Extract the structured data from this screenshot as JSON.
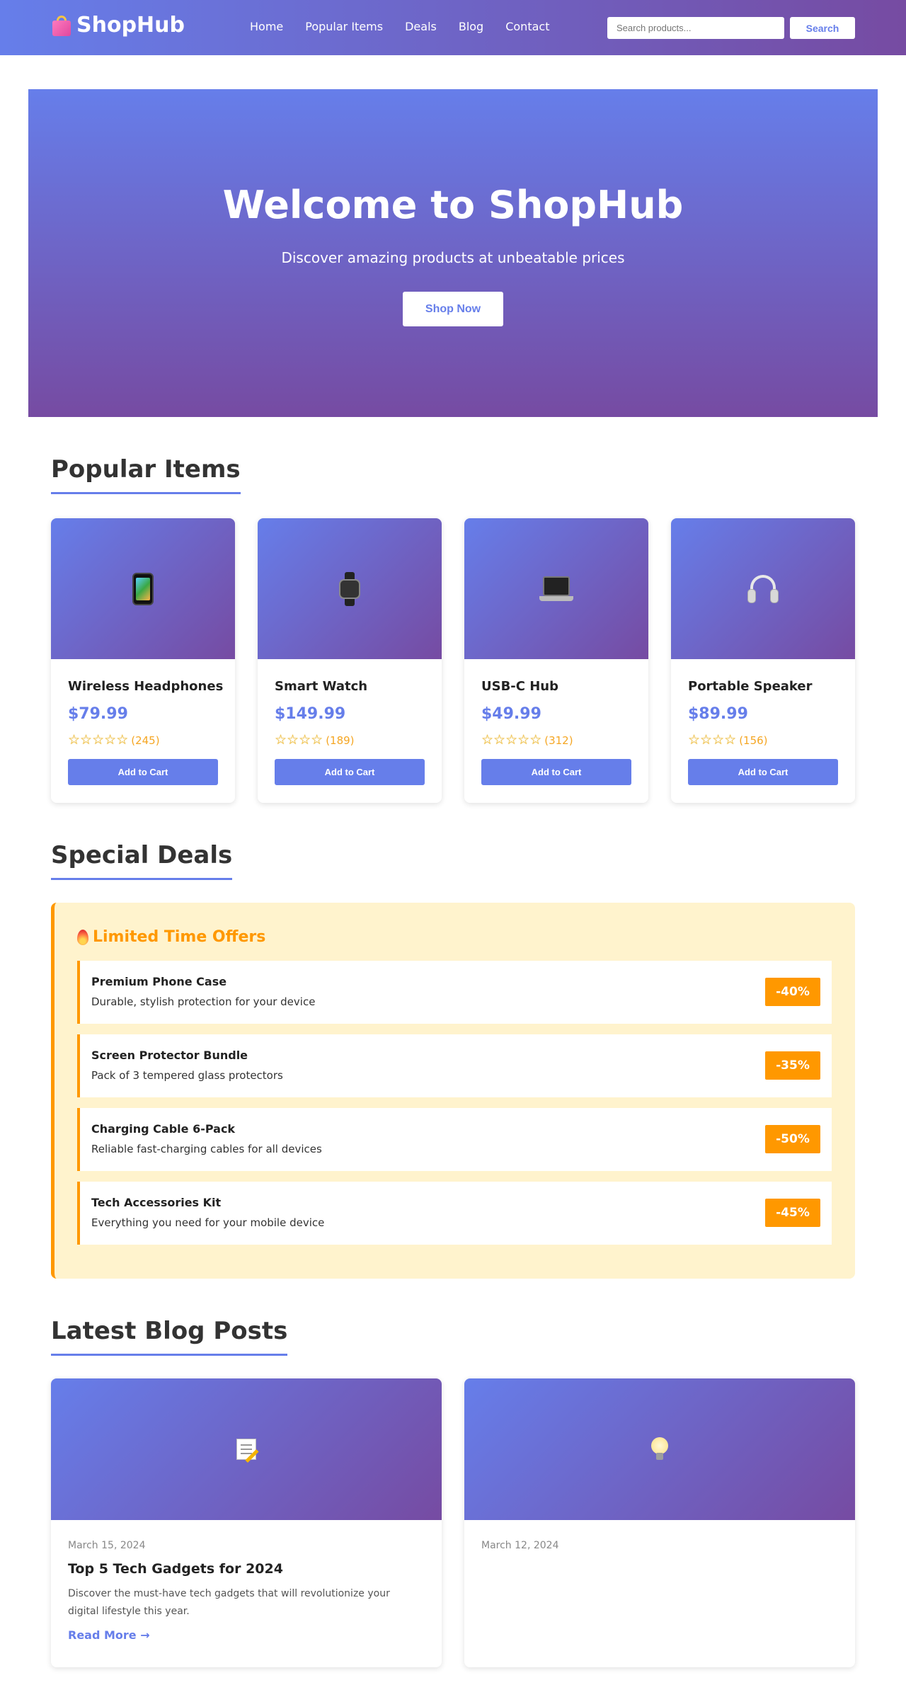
{
  "header": {
    "brand": "ShopHub",
    "nav": [
      "Home",
      "Popular Items",
      "Deals",
      "Blog",
      "Contact"
    ],
    "search_placeholder": "Search products...",
    "search_button": "Search"
  },
  "hero": {
    "title": "Welcome to ShopHub",
    "subtitle": "Discover amazing products at unbeatable prices",
    "cta": "Shop Now"
  },
  "popular": {
    "title": "Popular Items",
    "add_label": "Add to Cart",
    "items": [
      {
        "icon": "smartphone-icon",
        "name": "Wireless Headphones",
        "price": "$79.99",
        "stars": 5,
        "reviews": "(245)"
      },
      {
        "icon": "smartwatch-icon",
        "name": "Smart Watch",
        "price": "$149.99",
        "stars": 4,
        "reviews": "(189)"
      },
      {
        "icon": "laptop-icon",
        "name": "USB-C Hub",
        "price": "$49.99",
        "stars": 5,
        "reviews": "(312)"
      },
      {
        "icon": "headphones-icon",
        "name": "Portable Speaker",
        "price": "$89.99",
        "stars": 4,
        "reviews": "(156)"
      }
    ]
  },
  "deals": {
    "title": "Special Deals",
    "box_title": "Limited Time Offers",
    "items": [
      {
        "name": "Premium Phone Case",
        "desc": "Durable, stylish protection for your device",
        "discount": "-40%"
      },
      {
        "name": "Screen Protector Bundle",
        "desc": "Pack of 3 tempered glass protectors",
        "discount": "-35%"
      },
      {
        "name": "Charging Cable 6-Pack",
        "desc": "Reliable fast-charging cables for all devices",
        "discount": "-50%"
      },
      {
        "name": "Tech Accessories Kit",
        "desc": "Everything you need for your mobile device",
        "discount": "-45%"
      }
    ]
  },
  "blog": {
    "title": "Latest Blog Posts",
    "posts": [
      {
        "icon": "memo-icon",
        "date": "March 15, 2024",
        "title": "Top 5 Tech Gadgets for 2024",
        "excerpt": "Discover the must-have tech gadgets that will revolutionize your digital lifestyle this year.",
        "link": "Read More →"
      },
      {
        "icon": "lightbulb-icon",
        "date": "March 12, 2024",
        "title": "",
        "excerpt": "",
        "link": ""
      }
    ]
  },
  "colors": {
    "primary": "#667eea",
    "secondary": "#764ba2",
    "accent": "#ff9800",
    "deal_bg": "#fff3cd"
  }
}
